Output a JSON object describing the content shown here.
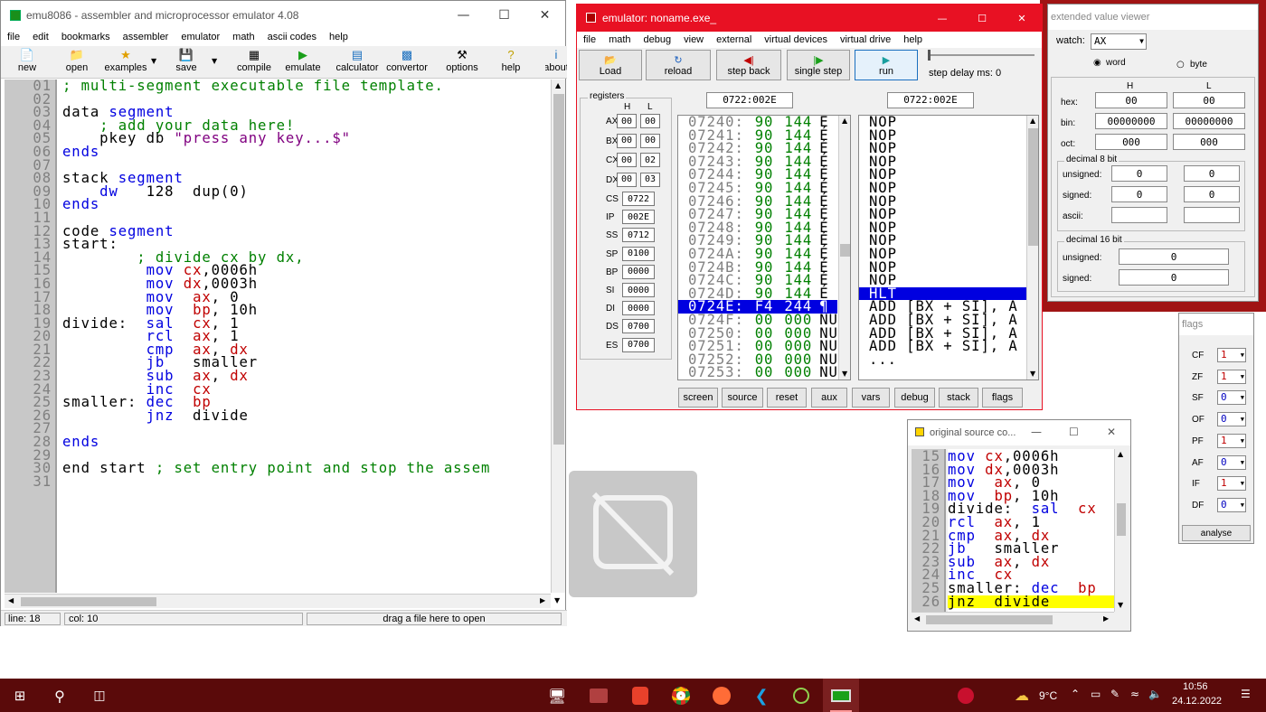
{
  "editor": {
    "title": "emu8086 - assembler and microprocessor emulator 4.08",
    "menu": [
      "file",
      "edit",
      "bookmarks",
      "assembler",
      "emulator",
      "math",
      "ascii codes",
      "help"
    ],
    "toolbar": [
      "new",
      "open",
      "examples",
      "save",
      "compile",
      "emulate",
      "calculator",
      "convertor",
      "options",
      "help",
      "about"
    ],
    "line_numbers": [
      "01",
      "02",
      "03",
      "04",
      "05",
      "06",
      "07",
      "08",
      "09",
      "10",
      "11",
      "12",
      "13",
      "14",
      "15",
      "16",
      "17",
      "18",
      "19",
      "20",
      "21",
      "22",
      "23",
      "24",
      "25",
      "26",
      "27",
      "28",
      "29",
      "30",
      "31"
    ],
    "code_lines": [
      [
        {
          "t": "; multi-segment executable file template.",
          "c": "cm"
        }
      ],
      [],
      [
        {
          "t": "data ",
          "c": ""
        },
        {
          "t": "segment",
          "c": "kw"
        }
      ],
      [
        {
          "t": "    ; add your data here!",
          "c": "cm"
        }
      ],
      [
        {
          "t": "    pkey db ",
          "c": ""
        },
        {
          "t": "\"press any key...$\"",
          "c": "st"
        }
      ],
      [
        {
          "t": "ends",
          "c": "kw"
        }
      ],
      [],
      [
        {
          "t": "stack ",
          "c": ""
        },
        {
          "t": "segment",
          "c": "kw"
        }
      ],
      [
        {
          "t": "    ",
          "c": ""
        },
        {
          "t": "dw",
          "c": "kw"
        },
        {
          "t": "   128  dup(0)",
          "c": ""
        }
      ],
      [
        {
          "t": "ends",
          "c": "kw"
        }
      ],
      [],
      [
        {
          "t": "code ",
          "c": ""
        },
        {
          "t": "segment",
          "c": "kw"
        }
      ],
      [
        {
          "t": "start:",
          "c": ""
        }
      ],
      [
        {
          "t": "        ; divide cx by dx,",
          "c": "cm"
        }
      ],
      [
        {
          "t": "         ",
          "c": ""
        },
        {
          "t": "mov",
          "c": "kw"
        },
        {
          "t": " ",
          "c": ""
        },
        {
          "t": "cx",
          "c": "reg"
        },
        {
          "t": ",0006h",
          "c": ""
        }
      ],
      [
        {
          "t": "         ",
          "c": ""
        },
        {
          "t": "mov",
          "c": "kw"
        },
        {
          "t": " ",
          "c": ""
        },
        {
          "t": "dx",
          "c": "reg"
        },
        {
          "t": ",0003h",
          "c": ""
        }
      ],
      [
        {
          "t": "         ",
          "c": ""
        },
        {
          "t": "mov",
          "c": "kw"
        },
        {
          "t": "  ",
          "c": ""
        },
        {
          "t": "ax",
          "c": "reg"
        },
        {
          "t": ", 0",
          "c": ""
        }
      ],
      [
        {
          "t": "         ",
          "c": ""
        },
        {
          "t": "mov",
          "c": "kw"
        },
        {
          "t": "  ",
          "c": ""
        },
        {
          "t": "bp",
          "c": "reg"
        },
        {
          "t": ", 10h",
          "c": ""
        }
      ],
      [
        {
          "t": "divide:  ",
          "c": ""
        },
        {
          "t": "sal",
          "c": "kw"
        },
        {
          "t": "  ",
          "c": ""
        },
        {
          "t": "cx",
          "c": "reg"
        },
        {
          "t": ", 1",
          "c": ""
        }
      ],
      [
        {
          "t": "         ",
          "c": ""
        },
        {
          "t": "rcl",
          "c": "kw"
        },
        {
          "t": "  ",
          "c": ""
        },
        {
          "t": "ax",
          "c": "reg"
        },
        {
          "t": ", 1",
          "c": ""
        }
      ],
      [
        {
          "t": "         ",
          "c": ""
        },
        {
          "t": "cmp",
          "c": "kw"
        },
        {
          "t": "  ",
          "c": ""
        },
        {
          "t": "ax",
          "c": "reg"
        },
        {
          "t": ", ",
          "c": ""
        },
        {
          "t": "dx",
          "c": "reg"
        }
      ],
      [
        {
          "t": "         ",
          "c": ""
        },
        {
          "t": "jb",
          "c": "kw"
        },
        {
          "t": "   smaller",
          "c": ""
        }
      ],
      [
        {
          "t": "         ",
          "c": ""
        },
        {
          "t": "sub",
          "c": "kw"
        },
        {
          "t": "  ",
          "c": ""
        },
        {
          "t": "ax",
          "c": "reg"
        },
        {
          "t": ", ",
          "c": ""
        },
        {
          "t": "dx",
          "c": "reg"
        }
      ],
      [
        {
          "t": "         ",
          "c": ""
        },
        {
          "t": "inc",
          "c": "kw"
        },
        {
          "t": "  ",
          "c": ""
        },
        {
          "t": "cx",
          "c": "reg"
        }
      ],
      [
        {
          "t": "smaller: ",
          "c": ""
        },
        {
          "t": "dec",
          "c": "kw"
        },
        {
          "t": "  ",
          "c": ""
        },
        {
          "t": "bp",
          "c": "reg"
        }
      ],
      [
        {
          "t": "         ",
          "c": ""
        },
        {
          "t": "jnz",
          "c": "kw"
        },
        {
          "t": "  divide",
          "c": ""
        }
      ],
      [],
      [
        {
          "t": "ends",
          "c": "kw"
        }
      ],
      [],
      [
        {
          "t": "end start ",
          "c": ""
        },
        {
          "t": "; set entry point and stop the assem",
          "c": "cm"
        }
      ],
      []
    ],
    "status": {
      "line": "line: 18",
      "col": "col: 10",
      "hint": "drag a file here to open"
    }
  },
  "emulator": {
    "title": "emulator: noname.exe_",
    "menu": [
      "file",
      "math",
      "debug",
      "view",
      "external",
      "virtual devices",
      "virtual drive",
      "help"
    ],
    "toolbar": {
      "load": "Load",
      "reload": "reload",
      "step_back": "step back",
      "single_step": "single step",
      "run": "run",
      "step_delay": "step delay ms: 0"
    },
    "registers_label": "registers",
    "h_label": "H",
    "l_label": "L",
    "regs_hl": [
      {
        "name": "AX",
        "h": "00",
        "l": "00"
      },
      {
        "name": "BX",
        "h": "00",
        "l": "00"
      },
      {
        "name": "CX",
        "h": "00",
        "l": "02"
      },
      {
        "name": "DX",
        "h": "00",
        "l": "03"
      }
    ],
    "regs_16": [
      {
        "name": "CS",
        "v": "0722"
      },
      {
        "name": "IP",
        "v": "002E"
      },
      {
        "name": "SS",
        "v": "0712"
      },
      {
        "name": "SP",
        "v": "0100"
      },
      {
        "name": "BP",
        "v": "0000"
      },
      {
        "name": "SI",
        "v": "0000"
      },
      {
        "name": "DI",
        "v": "0000"
      },
      {
        "name": "DS",
        "v": "0700"
      },
      {
        "name": "ES",
        "v": "0700"
      }
    ],
    "addr_left": "0722:002E",
    "addr_right": "0722:002E",
    "mem_rows": [
      {
        "a": "07240:",
        "h": "90",
        "d": "144",
        "c": "É"
      },
      {
        "a": "07241:",
        "h": "90",
        "d": "144",
        "c": "É"
      },
      {
        "a": "07242:",
        "h": "90",
        "d": "144",
        "c": "É"
      },
      {
        "a": "07243:",
        "h": "90",
        "d": "144",
        "c": "É"
      },
      {
        "a": "07244:",
        "h": "90",
        "d": "144",
        "c": "É"
      },
      {
        "a": "07245:",
        "h": "90",
        "d": "144",
        "c": "É"
      },
      {
        "a": "07246:",
        "h": "90",
        "d": "144",
        "c": "É"
      },
      {
        "a": "07247:",
        "h": "90",
        "d": "144",
        "c": "É"
      },
      {
        "a": "07248:",
        "h": "90",
        "d": "144",
        "c": "É"
      },
      {
        "a": "07249:",
        "h": "90",
        "d": "144",
        "c": "É"
      },
      {
        "a": "0724A:",
        "h": "90",
        "d": "144",
        "c": "É"
      },
      {
        "a": "0724B:",
        "h": "90",
        "d": "144",
        "c": "É"
      },
      {
        "a": "0724C:",
        "h": "90",
        "d": "144",
        "c": "É"
      },
      {
        "a": "0724D:",
        "h": "90",
        "d": "144",
        "c": "É"
      },
      {
        "a": "0724E:",
        "h": "F4",
        "d": "244",
        "c": "¶"
      },
      {
        "a": "0724F:",
        "h": "00",
        "d": "000",
        "c": "NU"
      },
      {
        "a": "07250:",
        "h": "00",
        "d": "000",
        "c": "NU"
      },
      {
        "a": "07251:",
        "h": "00",
        "d": "000",
        "c": "NU"
      },
      {
        "a": "07252:",
        "h": "00",
        "d": "000",
        "c": "NU"
      },
      {
        "a": "07253:",
        "h": "00",
        "d": "000",
        "c": "NU"
      }
    ],
    "selected_mem_index": 14,
    "disasm_rows": [
      "NOP",
      "NOP",
      "NOP",
      "NOP",
      "NOP",
      "NOP",
      "NOP",
      "NOP",
      "NOP",
      "NOP",
      "NOP",
      "NOP",
      "NOP",
      "HLT",
      "ADD [BX + SI], A",
      "ADD [BX + SI], A",
      "ADD [BX + SI], A",
      "ADD [BX + SI], A",
      "..."
    ],
    "selected_disasm_index": 13,
    "bottom_buttons": [
      "screen",
      "source",
      "reset",
      "aux",
      "vars",
      "debug",
      "stack",
      "flags"
    ]
  },
  "viewer": {
    "title": "extended value viewer",
    "watch_label": "watch:",
    "watch_value": "AX",
    "word_label": "word",
    "byte_label": "byte",
    "h_label": "H",
    "l_label": "L",
    "hex_label": "hex:",
    "hex_h": "00",
    "hex_l": "00",
    "bin_label": "bin:",
    "bin_h": "00000000",
    "bin_l": "00000000",
    "oct_label": "oct:",
    "oct_h": "000",
    "oct_l": "000",
    "dec8_label": "decimal 8 bit",
    "unsigned_label": "unsigned:",
    "u8_h": "0",
    "u8_l": "0",
    "signed_label": "signed:",
    "s8_h": "0",
    "s8_l": "0",
    "ascii_label": "ascii:",
    "dec16_label": "decimal 16 bit",
    "u16": "0",
    "s16": "0"
  },
  "flags": {
    "title": "flags",
    "items": [
      {
        "name": "CF",
        "v": "1"
      },
      {
        "name": "ZF",
        "v": "1"
      },
      {
        "name": "SF",
        "v": "0"
      },
      {
        "name": "OF",
        "v": "0"
      },
      {
        "name": "PF",
        "v": "1"
      },
      {
        "name": "AF",
        "v": "0"
      },
      {
        "name": "IF",
        "v": "1"
      },
      {
        "name": "DF",
        "v": "0"
      }
    ],
    "analyse": "analyse"
  },
  "source": {
    "title": "original source co...",
    "line_numbers": [
      "15",
      "16",
      "17",
      "18",
      "19",
      "20",
      "21",
      "22",
      "23",
      "24",
      "25",
      "26"
    ],
    "code_lines": [
      [
        {
          "t": "mov ",
          "c": "kw"
        },
        {
          "t": "cx",
          "c": "reg"
        },
        {
          "t": ",0006h",
          "c": ""
        }
      ],
      [
        {
          "t": "mov ",
          "c": "kw"
        },
        {
          "t": "dx",
          "c": "reg"
        },
        {
          "t": ",0003h",
          "c": ""
        }
      ],
      [
        {
          "t": "mov  ",
          "c": "kw"
        },
        {
          "t": "ax",
          "c": "reg"
        },
        {
          "t": ", 0",
          "c": ""
        }
      ],
      [
        {
          "t": "mov  ",
          "c": "kw"
        },
        {
          "t": "bp",
          "c": "reg"
        },
        {
          "t": ", 10h",
          "c": ""
        }
      ],
      [
        {
          "t": "divide:  ",
          "c": ""
        },
        {
          "t": "sal",
          "c": "kw"
        },
        {
          "t": "  cx",
          "c": "reg"
        }
      ],
      [
        {
          "t": "rcl  ",
          "c": "kw"
        },
        {
          "t": "ax",
          "c": "reg"
        },
        {
          "t": ", 1",
          "c": ""
        }
      ],
      [
        {
          "t": "cmp  ",
          "c": "kw"
        },
        {
          "t": "ax",
          "c": "reg"
        },
        {
          "t": ", ",
          "c": ""
        },
        {
          "t": "dx",
          "c": "reg"
        }
      ],
      [
        {
          "t": "jb",
          "c": "kw"
        },
        {
          "t": "   smaller",
          "c": ""
        }
      ],
      [
        {
          "t": "sub  ",
          "c": "kw"
        },
        {
          "t": "ax",
          "c": "reg"
        },
        {
          "t": ", ",
          "c": ""
        },
        {
          "t": "dx",
          "c": "reg"
        }
      ],
      [
        {
          "t": "inc  ",
          "c": "kw"
        },
        {
          "t": "cx",
          "c": "reg"
        }
      ],
      [
        {
          "t": "smaller: ",
          "c": ""
        },
        {
          "t": "dec  ",
          "c": "kw"
        },
        {
          "t": "bp",
          "c": "reg"
        }
      ],
      [
        {
          "t": "jnz  divide",
          "c": ""
        }
      ]
    ],
    "highlight_index": 11
  },
  "taskbar": {
    "temperature": "9°C",
    "time": "10:56",
    "date": "24.12.2022"
  },
  "colors": {
    "taskbar": "#5a0a0a",
    "emu_title": "#e81123",
    "selection": "#0000e0",
    "highlight": "#ffff00"
  }
}
